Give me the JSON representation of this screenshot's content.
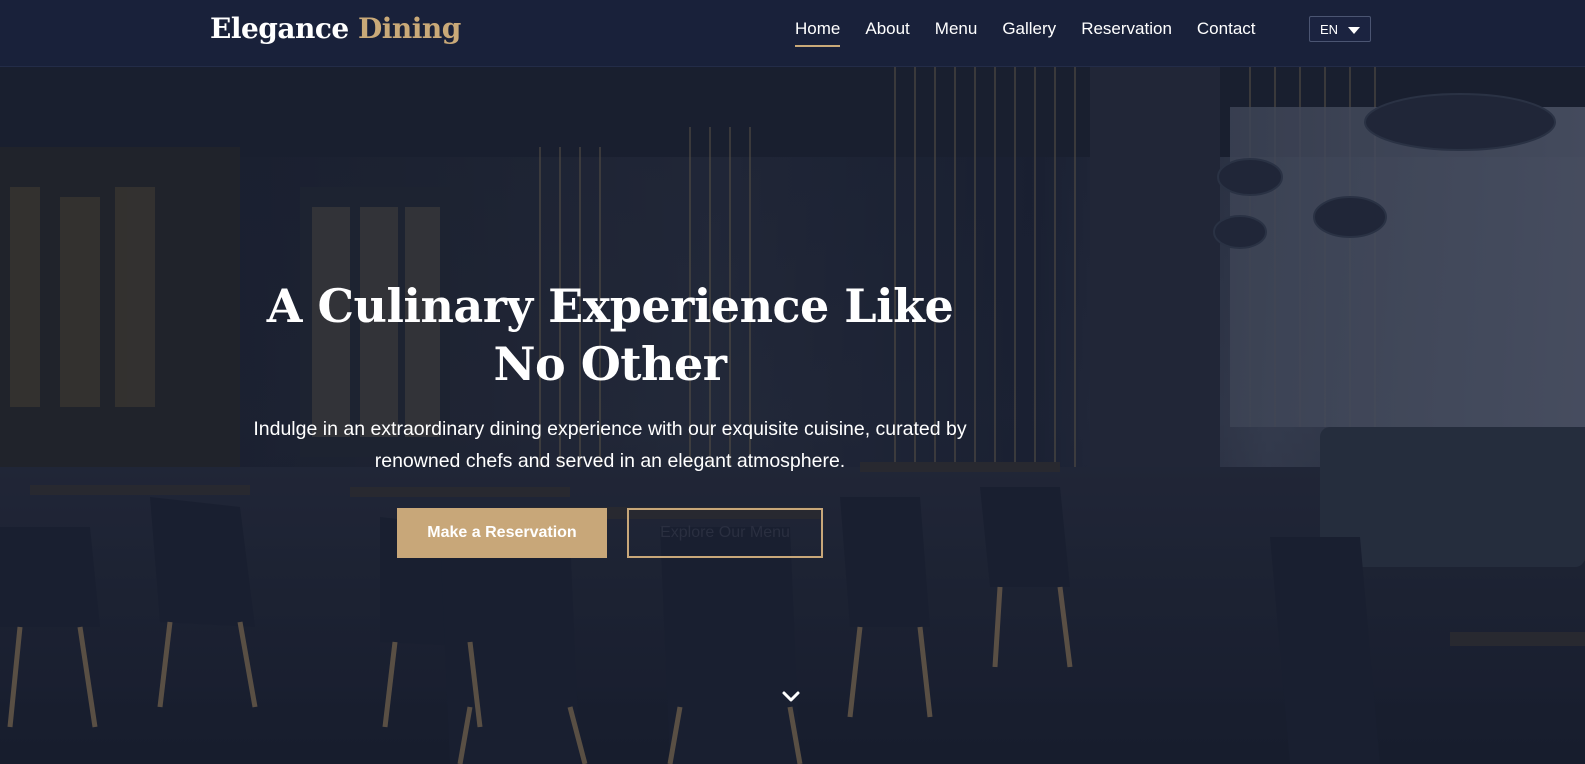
{
  "brand": {
    "name_part1": "Elegance",
    "name_part2": "Dining",
    "accent_color": "#c9a978",
    "nav_bg": "#19213a"
  },
  "nav": {
    "items": [
      {
        "label": "Home",
        "active": true
      },
      {
        "label": "About"
      },
      {
        "label": "Menu"
      },
      {
        "label": "Gallery"
      },
      {
        "label": "Reservation"
      },
      {
        "label": "Contact"
      }
    ],
    "language": {
      "selected": "EN",
      "icon": "caret-down-icon"
    }
  },
  "hero": {
    "title": "A Culinary Experience Like No Other",
    "subtitle": "Indulge in an extraordinary dining experience with our exquisite cuisine, curated by renowned chefs and served in an elegant atmosphere.",
    "primary_button": "Make a Reservation",
    "secondary_button": "Explore Our Menu",
    "scroll_icon": "chevron-down-icon"
  }
}
